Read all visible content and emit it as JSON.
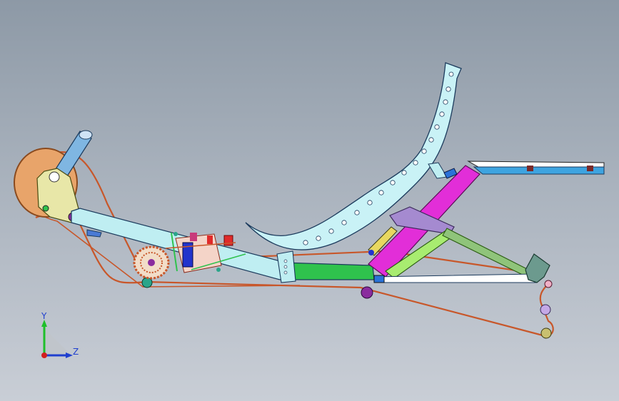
{
  "viewport": {
    "background_top": "#8d99a6",
    "background_bottom": "#c9ced6"
  },
  "triad": {
    "y_label": "Y",
    "z_label": "Z",
    "x_color": "#d21f1f",
    "y_color": "#1fbf2a",
    "z_color": "#1f3fcf"
  },
  "colors": {
    "frame_tube": "#bfeef2",
    "seat": "#c9f2f6",
    "chain": "#c8572a",
    "crank_disc": "#e8a46a",
    "link_green": "#2fc24d",
    "link_magenta": "#e22ed8",
    "link_lightgreen": "#a8ec70",
    "link_purple": "#a58ad0",
    "drivetrain_blue": "#2233cc",
    "idler_purple": "#8a2c9e",
    "idler_teal": "#2aa58a"
  }
}
